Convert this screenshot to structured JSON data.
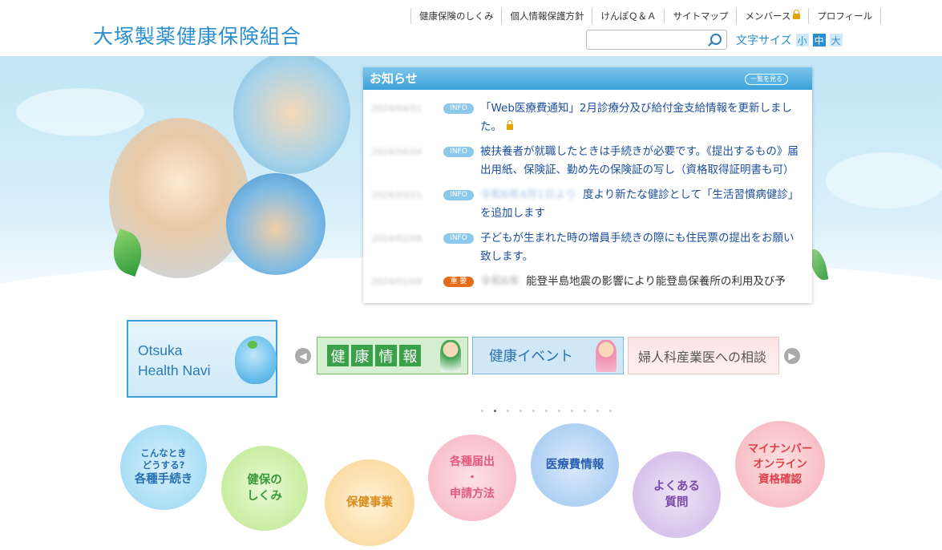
{
  "header": {
    "logo": "大塚製薬健康保険組合",
    "topnav": [
      "健康保険のしくみ",
      "個人情報保護方針",
      "けんぽＱ＆Ａ",
      "サイトマップ",
      "メンバース",
      "プロフィール"
    ],
    "search_placeholder": "",
    "fontsize_label": "文字サイズ",
    "fontsize_options": [
      "小",
      "中",
      "大"
    ]
  },
  "news": {
    "title": "お知らせ",
    "more_label": "一覧を見る",
    "items": [
      {
        "badge": "INFO",
        "text": "「Web医療費通知」2月診療分及び給付金支給情報を更新しました。"
      },
      {
        "badge": "INFO",
        "text": "被扶養者が就職したときは手続きが必要です。《提出するもの》届出用紙、保険証、勤め先の保険証の写し（資格取得証明書も可）"
      },
      {
        "badge": "INFO",
        "text": "度より新たな健診として「生活習慣病健診」を追加します"
      },
      {
        "badge": "INFO",
        "text": "子どもが生まれた時の増員手続きの際にも住民票の提出をお願い致します。"
      },
      {
        "badge": "重 要",
        "text": "能登半島地震の影響により能登島保養所の利用及び予"
      }
    ]
  },
  "navi": {
    "line1": "Otsuka",
    "line2": "Health Navi"
  },
  "banners": {
    "b1": [
      "健",
      "康",
      "情",
      "報"
    ],
    "b2": "健康イベント",
    "b3": "婦人科産業医への相談"
  },
  "circles": {
    "c1_small": "こんなとき\nどうする?",
    "c1": "各種手続き",
    "c2": "健保の\nしくみ",
    "c3": "保健事業",
    "c4": "各種届出\n・\n申請方法",
    "c5": "医療費情報",
    "c6": "よくある\n質問",
    "c7": "マイナンバー\nオンライン\n資格確認"
  }
}
